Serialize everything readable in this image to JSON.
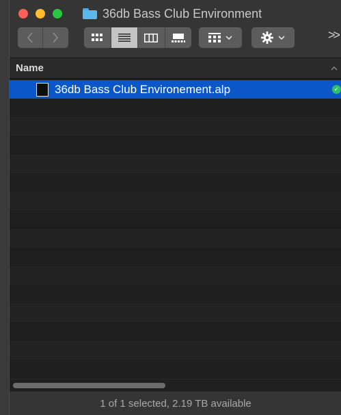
{
  "window": {
    "title": "36db Bass Club Environment",
    "folder_icon": "folder-icon",
    "traffic_lights": {
      "close": "#ff5f57",
      "minimize": "#febc2e",
      "zoom": "#28c840"
    }
  },
  "toolbar": {
    "back_icon": "chevron-left-icon",
    "forward_icon": "chevron-right-icon",
    "view_modes": [
      {
        "name": "icon-view",
        "icon": "grid-icon",
        "active": false
      },
      {
        "name": "list-view",
        "icon": "list-icon",
        "active": true
      },
      {
        "name": "column-view",
        "icon": "columns-icon",
        "active": false
      },
      {
        "name": "gallery-view",
        "icon": "gallery-icon",
        "active": false
      }
    ],
    "group_icon": "group-grid-icon",
    "action_icon": "gear-icon",
    "overflow_label": ">>"
  },
  "list": {
    "column_header": "Name",
    "files": [
      {
        "name": "36db Bass Club Environement.alp",
        "selected": true,
        "status_icon": "synced-check-icon"
      }
    ],
    "empty_row_count": 15
  },
  "status": {
    "text": "1 of 1 selected, 2.19 TB available"
  },
  "colors": {
    "selection": "#0b57c9",
    "check": "#2ac16a"
  }
}
